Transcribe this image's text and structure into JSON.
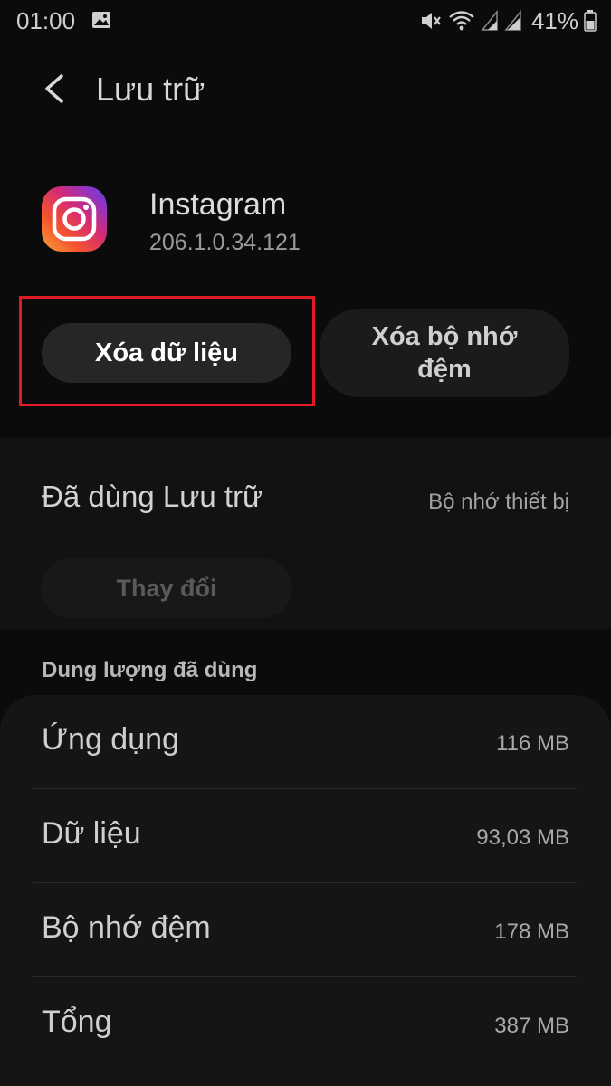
{
  "status_bar": {
    "time": "01:00",
    "battery_percent": "41%",
    "icons": [
      "image-icon",
      "mute-icon",
      "wifi-icon",
      "signal-icon",
      "signal-icon",
      "battery-icon"
    ]
  },
  "header": {
    "back_icon": "chevron-left-icon",
    "title": "Lưu trữ"
  },
  "app": {
    "icon": "instagram-icon",
    "name": "Instagram",
    "version": "206.1.0.34.121"
  },
  "actions": {
    "clear_data_label": "Xóa dữ liệu",
    "clear_cache_label": "Xóa bộ nhớ đệm",
    "highlight_color": "#e01b23"
  },
  "storage": {
    "used_label": "Đã dùng Lưu trữ",
    "location": "Bộ nhớ thiết bị",
    "change_label": "Thay đổi"
  },
  "usage": {
    "heading": "Dung lượng đã dùng",
    "rows": [
      {
        "label": "Ứng dụng",
        "value": "116 MB"
      },
      {
        "label": "Dữ liệu",
        "value": "93,03 MB"
      },
      {
        "label": "Bộ nhớ đệm",
        "value": "178 MB"
      },
      {
        "label": "Tổng",
        "value": "387 MB"
      }
    ]
  }
}
